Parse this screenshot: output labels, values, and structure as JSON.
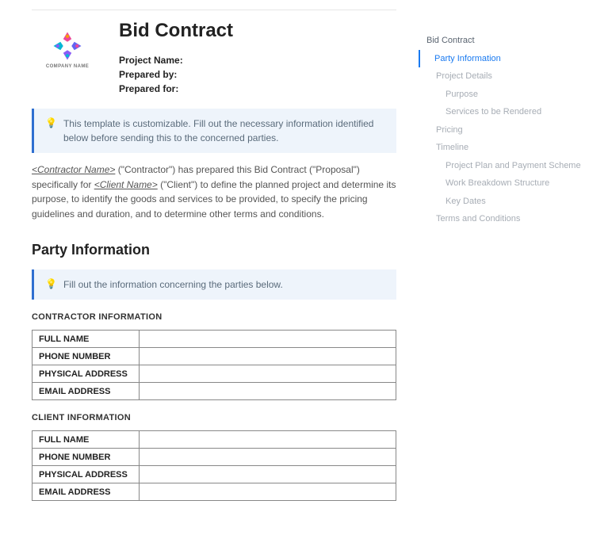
{
  "logo": {
    "company_label": "COMPANY NAME",
    "company_sub": ""
  },
  "header": {
    "title": "Bid Contract",
    "meta": {
      "project_name_label": "Project Name:",
      "prepared_by_label": "Prepared by:",
      "prepared_for_label": "Prepared for:"
    }
  },
  "callout_main": {
    "text": "This template is customizable. Fill out the necessary information identified below before sending this to the concerned parties."
  },
  "intro": {
    "p1a": "<Contractor Name>",
    "p1b": " (\"Contractor\") has prepared this Bid Contract (\"Proposal\") specifically for ",
    "p1c": "<Client Name>",
    "p1d": " (\"Client\") to define the planned project and determine its purpose, to identify the goods and services to be provided, to specify the pricing guidelines and duration, and to determine other terms and conditions."
  },
  "section_party": {
    "heading": "Party Information",
    "callout_text": "Fill out the information concerning the parties below.",
    "contractor_heading": "CONTRACTOR INFORMATION",
    "client_heading": "CLIENT INFORMATION",
    "rows": {
      "full_name": "FULL NAME",
      "phone": "PHONE NUMBER",
      "address": "PHYSICAL ADDRESS",
      "email": "EMAIL ADDRESS"
    }
  },
  "nav": {
    "root": "Bid Contract",
    "items": [
      "Party Information",
      "Project Details",
      "Purpose",
      "Services to be Rendered",
      "Pricing",
      "Timeline",
      "Project Plan and Payment Scheme",
      "Work Breakdown Structure",
      "Key Dates",
      "Terms and Conditions"
    ]
  }
}
